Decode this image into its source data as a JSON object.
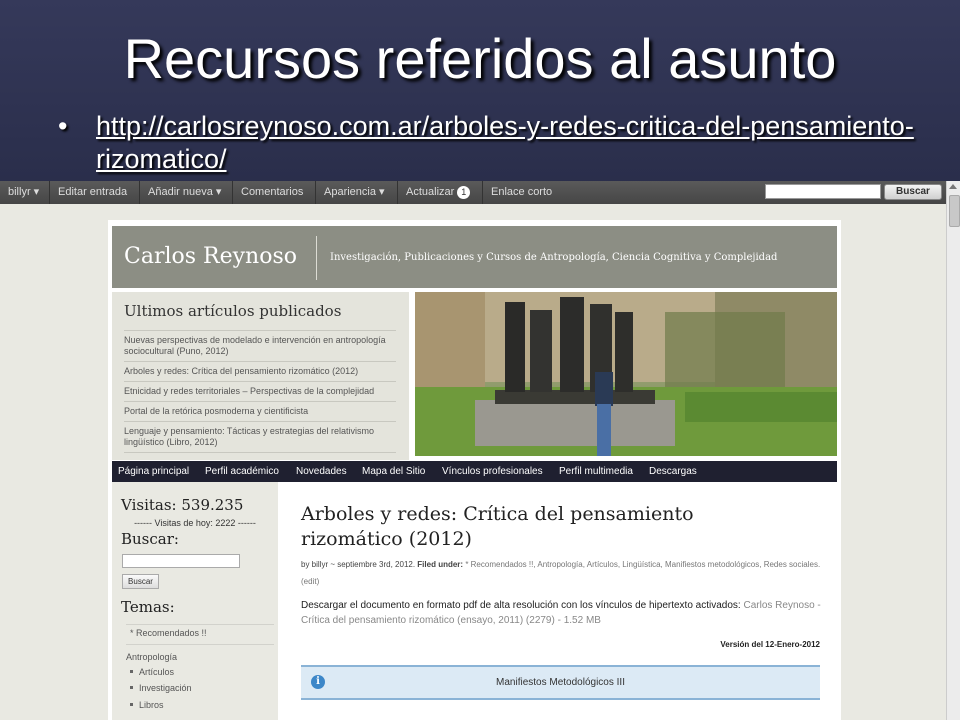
{
  "slide": {
    "title": "Recursos referidos al asunto",
    "bullet_link": "http://carlosreynoso.com.ar/arboles-y-redes-critica-del-pensamiento-rizomatico/"
  },
  "adminbar": {
    "items": [
      "billyr ▾",
      "Editar entrada",
      "Añadir nueva ▾",
      "Comentarios",
      "Apariencia ▾",
      "Actualizar",
      "Enlace corto"
    ],
    "update_count": "1",
    "search_button": "Buscar"
  },
  "site": {
    "name": "Carlos Reynoso",
    "tagline": "Investigación, Publicaciones y Cursos de Antropología, Ciencia Cognitiva y Complejidad"
  },
  "latest": {
    "heading": "Ultimos artículos publicados",
    "items": [
      "Nuevas perspectivas de modelado e intervención en antropología sociocultural (Puno, 2012)",
      "Arboles y redes: Crítica del pensamiento rizomático (2012)",
      "Etnicidad y redes territoriales – Perspectivas de la complejidad",
      "Portal de la retórica posmoderna y cientificista",
      "Lenguaje y pensamiento: Tácticas y estrategias del relativismo lingüístico (Libro, 2012)"
    ]
  },
  "nav": [
    "Página principal",
    "Perfil académico",
    "Novedades",
    "Mapa del Sitio",
    "Vínculos profesionales",
    "Perfil multimedia",
    "Descargas"
  ],
  "sidebar": {
    "visits": "Visitas: 539.235",
    "visits_today": "------ Visitas de hoy: 2222 ------",
    "search_heading": "Buscar:",
    "search_button": "Buscar",
    "topics_heading": "Temas:",
    "categories": [
      "* Recomendados !!",
      "Antropología",
      "Artículos",
      "Investigación",
      "Libros"
    ]
  },
  "post": {
    "title": "Arboles y redes: Crítica del pensamiento rizomático (2012)",
    "meta_prefix": "by billyr ~ septiembre 3rd, 2012.",
    "meta_filed": "Filed under:",
    "meta_categories": "* Recomendados !!, Antropología, Artículos, Lingüística, Manifiestos metodológicos, Redes sociales.",
    "meta_edit": "(edit)",
    "desc_text": "Descargar el documento en formato pdf de alta resolución con los vínculos de hipertexto activados:",
    "desc_link": "Carlos Reynoso - Crítica del pensamiento rizomático (ensayo, 2011) (2279) - 1.52 MB",
    "version": "Versión del 12-Enero-2012",
    "box_label": "Manifiestos Metodológicos III"
  },
  "colors": {
    "slide_bg": "#2f3350",
    "header_gray": "#8c8e84",
    "nav_dark": "#1f2030",
    "info_blue": "#3d87c8"
  }
}
